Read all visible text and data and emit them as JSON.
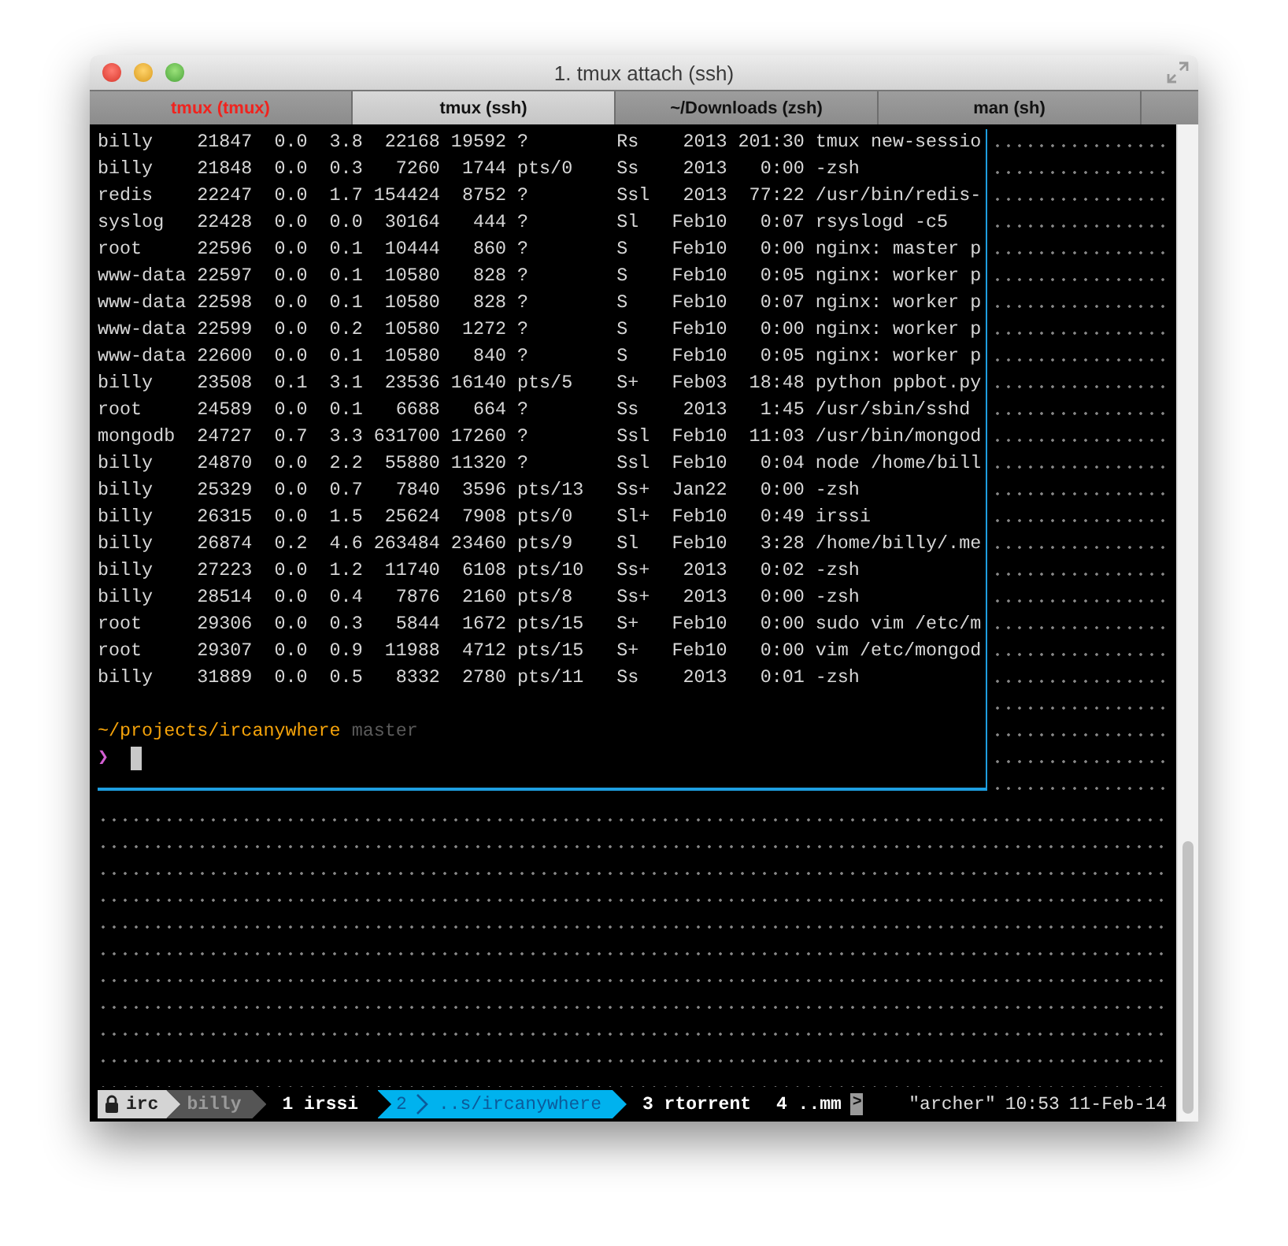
{
  "window": {
    "title": "1. tmux attach (ssh)"
  },
  "tabs": [
    {
      "label": "tmux (tmux)",
      "selected": false,
      "alert": true
    },
    {
      "label": "tmux (ssh)",
      "selected": true,
      "alert": false
    },
    {
      "label": "~/Downloads (zsh)",
      "selected": false,
      "alert": false
    },
    {
      "label": "man (sh)",
      "selected": false,
      "alert": false
    }
  ],
  "main_pane": {
    "lines": [
      "billy    21847  0.0  3.8  22168 19592 ?        Rs    2013 201:30 tmux new-sessio",
      "billy    21848  0.0  0.3   7260  1744 pts/0    Ss    2013   0:00 -zsh",
      "redis    22247  0.0  1.7 154424  8752 ?        Ssl   2013  77:22 /usr/bin/redis-",
      "syslog   22428  0.0  0.0  30164   444 ?        Sl   Feb10   0:07 rsyslogd -c5",
      "root     22596  0.0  0.1  10444   860 ?        S    Feb10   0:00 nginx: master p",
      "www-data 22597  0.0  0.1  10580   828 ?        S    Feb10   0:05 nginx: worker p",
      "www-data 22598  0.0  0.1  10580   828 ?        S    Feb10   0:07 nginx: worker p",
      "www-data 22599  0.0  0.2  10580  1272 ?        S    Feb10   0:00 nginx: worker p",
      "www-data 22600  0.0  0.1  10580   840 ?        S    Feb10   0:05 nginx: worker p",
      "billy    23508  0.1  3.1  23536 16140 pts/5    S+   Feb03  18:48 python ppbot.py",
      "root     24589  0.0  0.1   6688   664 ?        Ss    2013   1:45 /usr/sbin/sshd",
      "mongodb  24727  0.7  3.3 631700 17260 ?        Ssl  Feb10  11:03 /usr/bin/mongod",
      "billy    24870  0.0  2.2  55880 11320 ?        Ssl  Feb10   0:04 node /home/bill",
      "billy    25329  0.0  0.7   7840  3596 pts/13   Ss+  Jan22   0:00 -zsh",
      "billy    26315  0.0  1.5  25624  7908 pts/0    Sl+  Feb10   0:49 irssi",
      "billy    26874  0.2  4.6 263484 23460 pts/9    Sl   Feb10   3:28 /home/billy/.me",
      "billy    27223  0.0  1.2  11740  6108 pts/10   Ss+   2013   0:02 -zsh",
      "billy    28514  0.0  0.4   7876  2160 pts/8    Ss+   2013   0:00 -zsh",
      "root     29306  0.0  0.3   5844  1672 pts/15   S+   Feb10   0:00 sudo vim /etc/m",
      "root     29307  0.0  0.9  11988  4712 pts/15   S+   Feb10   0:00 vim /etc/mongod",
      "billy    31889  0.0  0.5   8332  2780 pts/11   Ss    2013   0:01 -zsh"
    ],
    "prompt": {
      "path": "~/projects/ircanywhere",
      "branch": "master",
      "symbol": "❯"
    }
  },
  "status_bar": {
    "session": "irc",
    "user": "billy",
    "windows": [
      {
        "index": "1",
        "name": "irssi",
        "selected": false
      },
      {
        "index": "2",
        "name": "..s/ircanywhere",
        "selected": true
      },
      {
        "index": "3",
        "name": "rtorrent",
        "selected": false
      },
      {
        "index": "4",
        "name": "..mm",
        "selected": false
      }
    ],
    "overflow_marker": ">",
    "host": "\"archer\"",
    "time": "10:53",
    "date": "11-Feb-14"
  }
}
